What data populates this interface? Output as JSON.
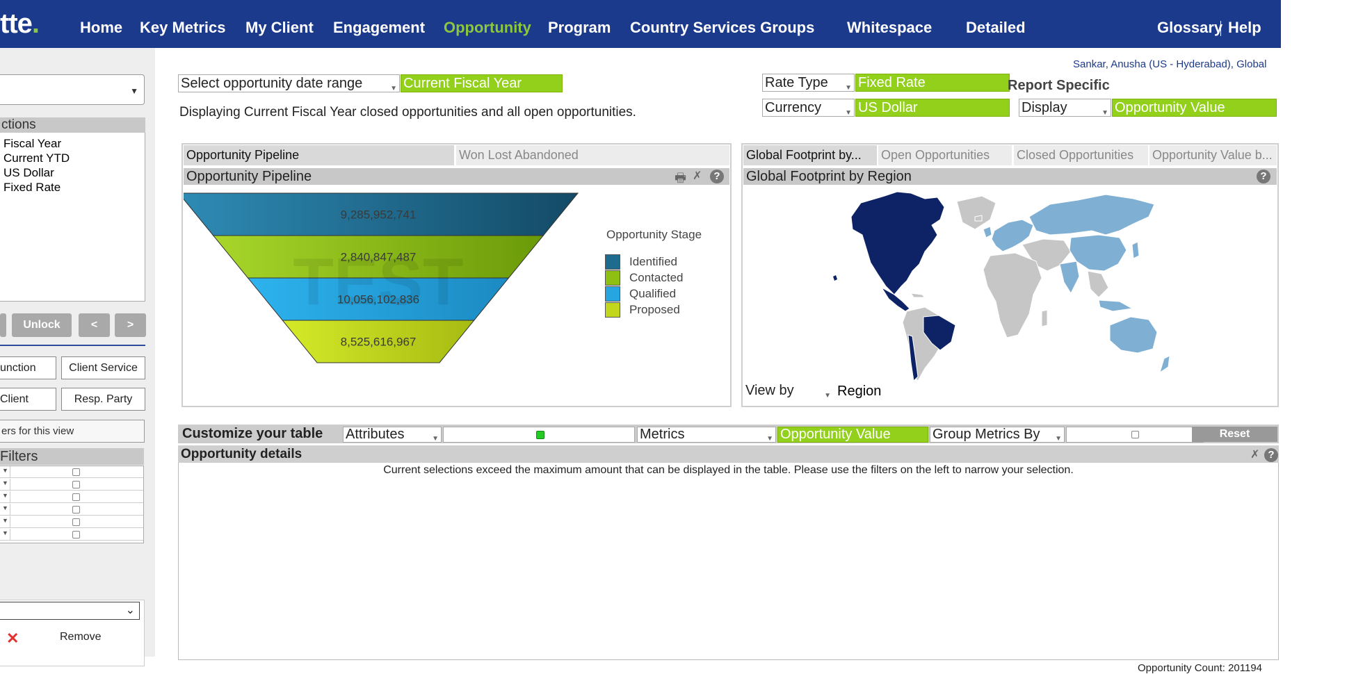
{
  "nav": {
    "logo": "tte",
    "logo_dot": ".",
    "items": [
      "Home",
      "Key Metrics",
      "My Client",
      "Engagement",
      "Opportunity",
      "Program",
      "Country Services Groups",
      "Whitespace",
      "Detailed"
    ],
    "active": "Opportunity",
    "glossary": "Glossary",
    "help": "Help"
  },
  "user": "Sankar, Anusha (US - Hyderabad), Global",
  "left": {
    "selections_header": "ctions",
    "selections": [
      "Fiscal Year",
      "Current YTD",
      "US Dollar",
      "Fixed Rate"
    ],
    "unlock": "Unlock",
    "prev": "<",
    "next": ">",
    "btn_function": "unction",
    "btn_client_service": "Client Service",
    "btn_client": "Client",
    "btn_resp_party": "Resp. Party",
    "filters_view": "ers for this view",
    "filters_header": "Filters",
    "remove": "Remove"
  },
  "controls": {
    "date_range_label": "Select opportunity date range",
    "date_range_value": "Current Fiscal Year",
    "date_info": "Displaying Current Fiscal Year closed opportunities and all open opportunities.",
    "rate_type_label": "Rate Type",
    "rate_type_value": "Fixed Rate",
    "currency_label": "Currency",
    "currency_value": "US Dollar",
    "report_specific": "Report Specific",
    "display_label": "Display",
    "display_value": "Opportunity Value"
  },
  "pipeline_panel": {
    "tabs": [
      "Opportunity Pipeline",
      "Won Lost Abandoned"
    ],
    "title": "Opportunity Pipeline",
    "watermark": "TEST",
    "legend_title": "Opportunity Stage"
  },
  "chart_data": {
    "type": "funnel",
    "categories": [
      "Identified",
      "Contacted",
      "Qualified",
      "Proposed"
    ],
    "values": [
      9285952741,
      2840847487,
      10056102836,
      8525616967
    ],
    "labels": [
      "9,285,952,741",
      "2,840,847,487",
      "10,056,102,836",
      "8,525,616,967"
    ],
    "colors": [
      "#1d6c8e",
      "#8fbf12",
      "#25a6e0",
      "#c2d61b"
    ],
    "legend_title": "Opportunity Stage",
    "legend_position": "right"
  },
  "map_panel": {
    "tabs": [
      "Global Footprint by...",
      "Open Opportunities",
      "Closed Opportunities",
      "Opportunity Value b..."
    ],
    "title": "Global Footprint by Region",
    "view_by_label": "View by",
    "view_by_value": "Region",
    "colors": {
      "high": "#0d2366",
      "mid": "#7fb0d4",
      "none": "#c6c6c6"
    }
  },
  "table": {
    "customize_label": "Customize your table",
    "attributes_label": "Attributes",
    "metrics_label": "Metrics",
    "metrics_value": "Opportunity Value",
    "group_label": "Group Metrics By",
    "reset": "Reset",
    "details_title": "Opportunity details",
    "message": "Current selections exceed the maximum amount that can be displayed in the table. Please use the filters on the left to narrow your selection.",
    "count": "Opportunity Count: 201194"
  }
}
